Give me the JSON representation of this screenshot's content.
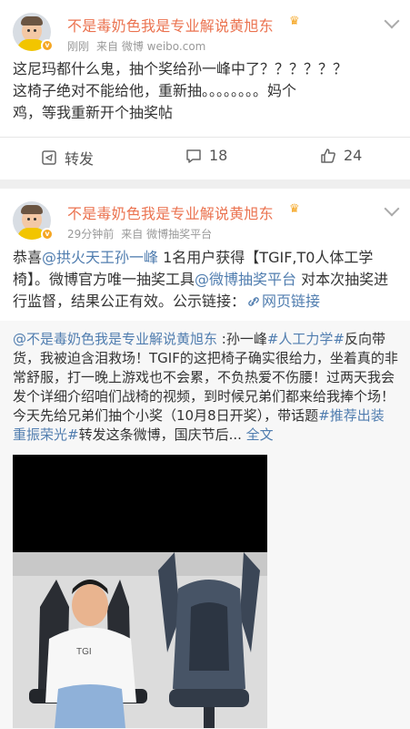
{
  "post1": {
    "username": "不是毒奶色我是专业解说黄旭东",
    "time": "刚刚",
    "source": "来自 微博 weibo.com",
    "text_lines": [
      "这尼玛都什么鬼，抽个奖给孙一峰中了？？？？？？",
      "这椅子绝对不能给他，重新抽。。。。。。。。妈个",
      "鸡，等我重新开个抽奖帖"
    ],
    "actions": {
      "repost": "转发",
      "comments": "18",
      "likes": "24"
    }
  },
  "post2": {
    "username": "不是毒奶色我是专业解说黄旭东",
    "time": "29分钟前",
    "source": "来自 微博抽奖平台",
    "text": {
      "p1": "恭喜",
      "mention": "@拱火天王孙一峰",
      "p2": " 1名用户获得【TGIF,T0人体工学椅】。微博官方唯一抽奖工具",
      "tool": "@微博抽奖平台",
      "p3": " 对本次抽奖进行监督，结果公正有效。公示链接：",
      "link_icon": "link-icon",
      "link": "网页链接"
    },
    "repost": {
      "mention": "@不是毒奶色我是专业解说黄旭东",
      "p1": " :孙一峰",
      "tag1": "#人工力学#",
      "p2": "反向带货，我被迫含泪救场！TGIF的这把椅子确实很给力，坐着真的非常舒服，打一晚上游戏也不会累，不负热爱不伤腰！过两天我会发个详细介绍咱们战椅的视频，到时候兄弟们都来给我捧个场！今天先给兄弟们抽个小奖（10月8日开奖），带话题",
      "tag2": "#推荐出装 重振荣光#",
      "p3": "转发这条微博，国庆节后...",
      "full": " 全文",
      "tgi_text": "TGI"
    }
  },
  "colors": {
    "username": "#eb7350",
    "link": "#507daf",
    "verified": "#f5a623"
  },
  "icons": {
    "verified": "verified-badge-icon",
    "crown": "crown-icon",
    "chevron": "chevron-down-icon",
    "repost": "repost-icon",
    "comment": "comment-icon",
    "like": "like-icon"
  }
}
